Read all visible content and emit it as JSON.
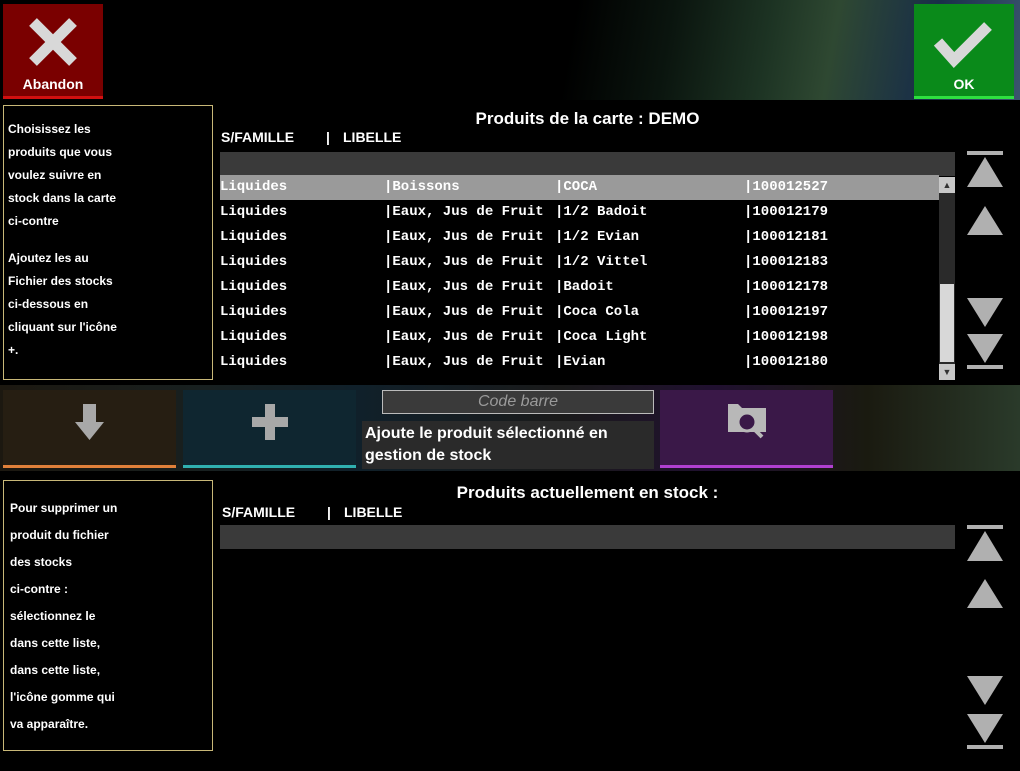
{
  "header": {
    "abandon_label": "Abandon",
    "ok_label": "OK",
    "abandon_color": "#7a0000",
    "ok_color": "#0a8a1a"
  },
  "help_top": {
    "lines": [
      "Choisissez les",
      "produits que vous",
      "voulez suivre en",
      "stock dans la carte",
      "ci-contre",
      "",
      "Ajoutez les au",
      "Fichier des stocks",
      "ci-dessous en",
      "cliquant sur l'icône",
      "+."
    ]
  },
  "card_products": {
    "title": "Produits de la carte : DEMO",
    "col_sfamille": "S/FAMILLE",
    "col_sep": "|",
    "col_libelle": "LIBELLE",
    "rows": [
      {
        "famille": "Liquides",
        "sousfamille": "|Boissons",
        "libelle": "|COCA",
        "code": "|100012527",
        "selected": true
      },
      {
        "famille": "Liquides",
        "sousfamille": "|Eaux, Jus de Fruit",
        "libelle": "|1/2 Badoit",
        "code": "|100012179",
        "selected": false
      },
      {
        "famille": "Liquides",
        "sousfamille": "|Eaux, Jus de Fruit",
        "libelle": "|1/2 Evian",
        "code": "|100012181",
        "selected": false
      },
      {
        "famille": "Liquides",
        "sousfamille": "|Eaux, Jus de Fruit",
        "libelle": "|1/2 Vittel",
        "code": "|100012183",
        "selected": false
      },
      {
        "famille": "Liquides",
        "sousfamille": "|Eaux, Jus de Fruit",
        "libelle": "|Badoit",
        "code": "|100012178",
        "selected": false
      },
      {
        "famille": "Liquides",
        "sousfamille": "|Eaux, Jus de Fruit",
        "libelle": "|Coca Cola",
        "code": "|100012197",
        "selected": false
      },
      {
        "famille": "Liquides",
        "sousfamille": "|Eaux, Jus de Fruit",
        "libelle": "|Coca Light",
        "code": "|100012198",
        "selected": false
      },
      {
        "famille": "Liquides",
        "sousfamille": "|Eaux, Jus de Fruit",
        "libelle": "|Evian",
        "code": "|100012180",
        "selected": false
      }
    ]
  },
  "actions": {
    "barcode_placeholder": "Code barre",
    "tooltip": "Ajoute le produit sélectionné en gestion de stock",
    "down_icon": "arrow-down-icon",
    "plus_icon": "plus-icon",
    "search_icon": "folder-search-icon"
  },
  "help_bottom": {
    "lines": [
      "Pour supprimer un",
      "produit du fichier",
      "des stocks",
      "ci-contre :",
      "sélectionnez le",
      "dans cette liste,",
      "dans cette liste,",
      "l'icône gomme qui",
      "va apparaître."
    ]
  },
  "stock_products": {
    "title": "Produits actuellement en stock :",
    "col_sfamille": "S/FAMILLE",
    "col_sep": "|",
    "col_libelle": "LIBELLE"
  }
}
